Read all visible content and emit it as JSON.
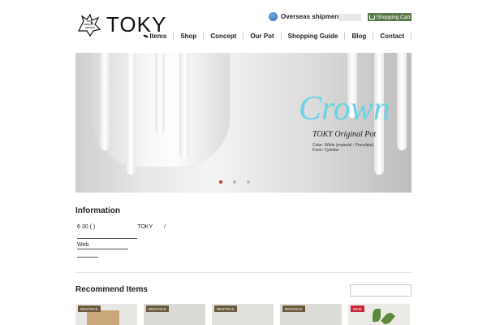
{
  "header": {
    "logo_text": "TOKY",
    "overseas_label": "Overseas shipment",
    "cart_label": "Shopping Cart"
  },
  "nav": {
    "items": [
      {
        "label": "Items",
        "icon": "leaf-icon"
      },
      {
        "label": "Shop"
      },
      {
        "label": "Concept"
      },
      {
        "label": "Our Pot"
      },
      {
        "label": "Shopping Guide"
      },
      {
        "label": "Blog"
      },
      {
        "label": "Contact"
      }
    ]
  },
  "hero": {
    "title": "Crown",
    "subtitle": "TOKY Original Pot",
    "spec_line1": "Color: White (material : Porcelain)",
    "spec_line2": "Form: Cylinder",
    "active_slide": 1,
    "slide_count": 3,
    "accent_color": "#69d3e6"
  },
  "information": {
    "title": "Information",
    "date": "6 30 ( )",
    "shop": "TOKY",
    "slash": "/",
    "web_label": "Web"
  },
  "recommend": {
    "title": "Recommend Items",
    "products": [
      {
        "badge": "RESTOCK"
      },
      {
        "badge": "RESTOCK"
      },
      {
        "badge": "RESTOCK"
      },
      {
        "badge": "RESTOCK"
      },
      {
        "badge": "NEW"
      }
    ]
  },
  "colors": {
    "cart_bg": "#5a7a4a",
    "restock_badge": "#6b5a3c",
    "new_badge": "#c9273c",
    "active_dot": "#d32b2b"
  }
}
